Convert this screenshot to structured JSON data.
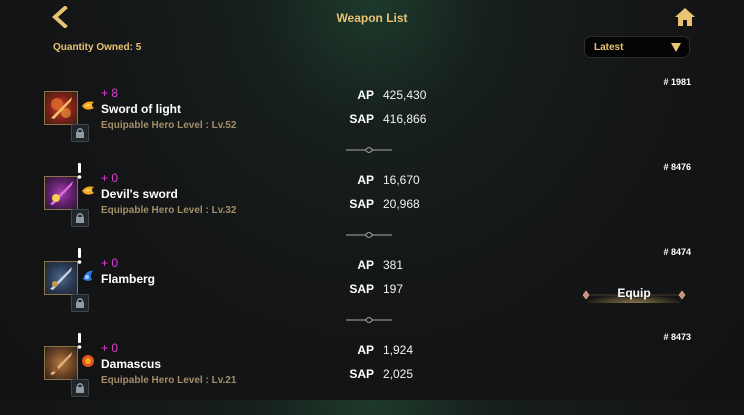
{
  "header": {
    "title": "Weapon List",
    "back_icon": "back-arrow-icon",
    "home_icon": "home-icon"
  },
  "quantity_label": "Quantity Owned: 5",
  "sort": {
    "selected": "Latest"
  },
  "weapons": [
    {
      "plus": "+ 8",
      "name": "Sword of light",
      "requirement": "Equipable Hero Level : Lv.52",
      "ap_label": "AP",
      "ap": "425,430",
      "sap_label": "SAP",
      "sap": "416,866",
      "serial": "# 1981",
      "element": "fire"
    },
    {
      "plus": "+ 0",
      "name": "Devil's sword",
      "requirement": "Equipable Hero Level : Lv.32",
      "ap_label": "AP",
      "ap": "16,670",
      "sap_label": "SAP",
      "sap": "20,968",
      "serial": "# 8476",
      "element": "fire"
    },
    {
      "plus": "+ 0",
      "name": "Flamberg",
      "requirement": "",
      "ap_label": "AP",
      "ap": "381",
      "sap_label": "SAP",
      "sap": "197",
      "serial": "# 8474",
      "element": "water",
      "equip_label": "Equip"
    },
    {
      "plus": "+ 0",
      "name": "Damascus",
      "requirement": "Equipable Hero Level : Lv.21",
      "ap_label": "AP",
      "ap": "1,924",
      "sap_label": "SAP",
      "sap": "2,025",
      "serial": "# 8473",
      "element": "fire"
    }
  ],
  "colors": {
    "gold": "#e8c372",
    "plus": "#e63ad8",
    "requirement": "#a48e68"
  }
}
